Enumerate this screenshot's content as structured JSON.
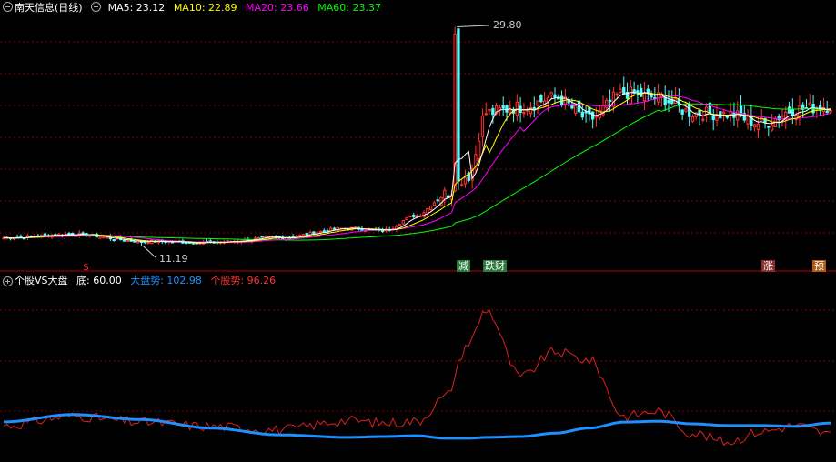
{
  "header": {
    "stock_name": "南天信息(日线)",
    "ma5": "MA5: 23.12",
    "ma10": "MA10: 22.89",
    "ma20": "MA20: 23.66",
    "ma60": "MA60: 23.37"
  },
  "indicator_header": {
    "name": "个股VS大盘",
    "bottom": "底: 60.00",
    "market": "大盘势: 102.98",
    "stock": "个股势: 96.26"
  },
  "annotations": {
    "high_price": "29.80",
    "low_price": "11.19",
    "signal_dollar": "$",
    "signal_reduce": "减",
    "signal_drop": "跌财",
    "signal_rise": "涨",
    "signal_pre": "预"
  },
  "colors": {
    "background": "#000000",
    "up": "#ff3232",
    "down": "#54fcfc",
    "ma5": "#ffffff",
    "ma10": "#ffff00",
    "ma20": "#ff00ff",
    "ma60": "#00ff00",
    "market_line": "#1e90ff",
    "stock_line": "#e02020",
    "grid": "#8b0000",
    "divider": "#b00000"
  },
  "chart_data": [
    {
      "type": "candlestick",
      "title": "南天信息(日线)",
      "y_range": [
        10.0,
        31.0
      ],
      "high_marker": 29.8,
      "low_marker": 11.19,
      "key_points": {
        "x": [
          0,
          20,
          40,
          60,
          80,
          100,
          110,
          120,
          128,
          135,
          140,
          150,
          160,
          170,
          180,
          190,
          200,
          210,
          220,
          230,
          240
        ],
        "close": [
          11.9,
          12.2,
          11.6,
          11.5,
          11.9,
          12.7,
          12.5,
          13.8,
          15.6,
          17.2,
          22.5,
          23.0,
          23.8,
          22.0,
          24.2,
          23.8,
          22.5,
          22.4,
          21.6,
          22.8,
          23.1
        ]
      },
      "legend": [
        "MA5: 23.12",
        "MA10: 22.89",
        "MA20: 23.66",
        "MA60: 23.37"
      ]
    },
    {
      "type": "line",
      "title": "个股VS大盘",
      "series": [
        {
          "name": "大盘势",
          "last": 102.98
        },
        {
          "name": "个股势",
          "last": 96.26
        }
      ],
      "key_points": {
        "x": [
          0,
          20,
          40,
          60,
          80,
          100,
          110,
          120,
          128,
          135,
          140,
          150,
          160,
          170,
          180,
          190,
          200,
          210,
          220,
          230,
          240
        ],
        "market": [
          103.6,
          108.0,
          105.0,
          100.0,
          96.0,
          94.5,
          95.0,
          95.5,
          94.0,
          94.0,
          94.5,
          95.0,
          97.0,
          100.0,
          103.5,
          104.0,
          102.5,
          101.5,
          101.5,
          101.0,
          102.98
        ],
        "stock": [
          101.5,
          107.0,
          103.5,
          101.0,
          99.0,
          104.5,
          103.0,
          104.0,
          118.0,
          150.0,
          170.0,
          130.0,
          145.0,
          140.0,
          107.0,
          110.0,
          97.0,
          92.0,
          98.0,
          101.5,
          96.26
        ]
      },
      "ylim": [
        80,
        185
      ]
    }
  ]
}
